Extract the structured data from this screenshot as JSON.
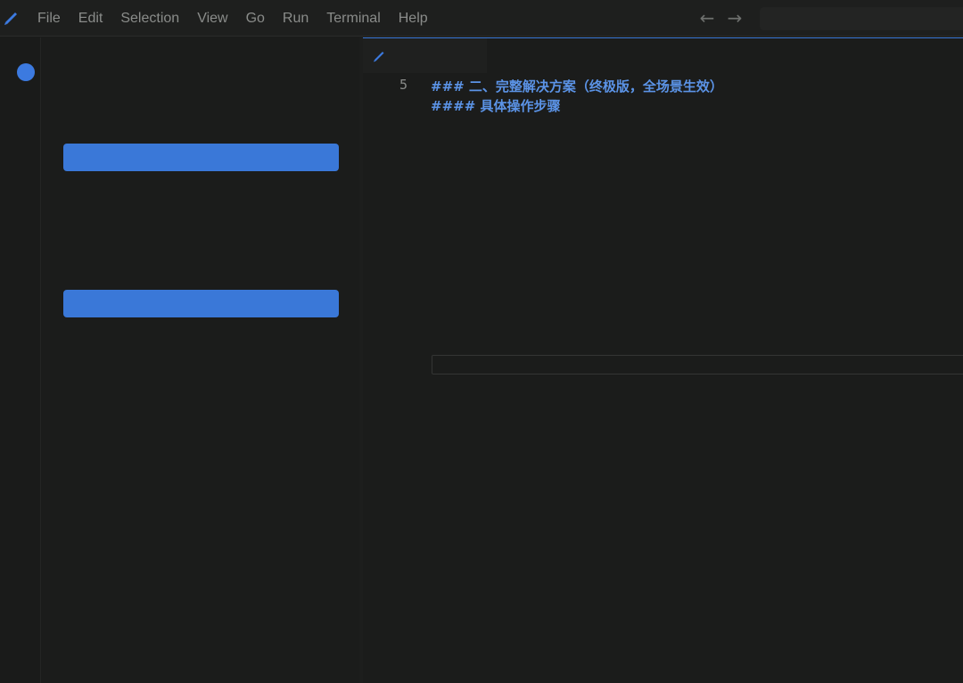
{
  "menu": {
    "items": [
      "File",
      "Edit",
      "Selection",
      "View",
      "Go",
      "Run",
      "Terminal",
      "Help"
    ]
  },
  "nav": {
    "back_icon": "←",
    "forward_icon": "→"
  },
  "icons": {
    "app": "pencil-icon",
    "tab": "pencil-icon",
    "activity": "circle-icon"
  },
  "colors": {
    "accent": "#3a78d8",
    "heading_text": "#5b93e6",
    "background": "#1b1c1b",
    "menu_text": "#8a8c8a"
  },
  "editor": {
    "line_number": "5",
    "lines": [
      "### 二、完整解决方案（终极版，全场景生效）",
      "#### 具体操作步骤"
    ],
    "input_value": ""
  },
  "sidepanel": {
    "button1_label": "",
    "button2_label": ""
  }
}
